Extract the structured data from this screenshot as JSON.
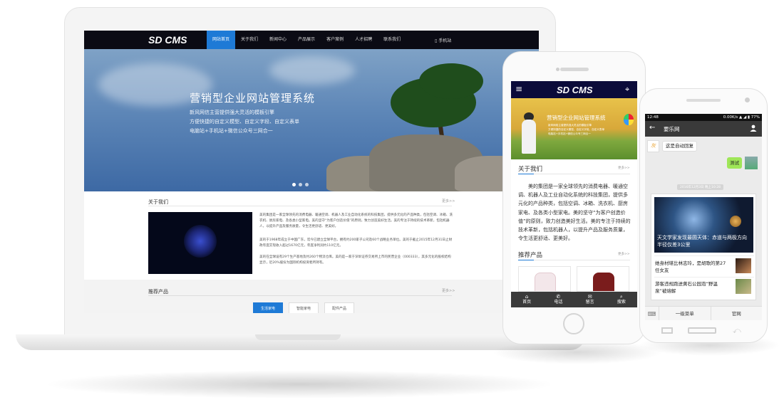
{
  "desktop": {
    "logo": "SD CMS",
    "menu": [
      "网站首页",
      "关于我们",
      "新闻中心",
      "产品展示",
      "客户案例",
      "人才招聘",
      "联系我们"
    ],
    "mobile_link": "手机站",
    "hero": {
      "title": "营销型企业网站管理系统",
      "lines": [
        "新风网信主营提供强大灵活的模板引擎",
        "方便快捷的自定义模型、自定义字段、自定义表单",
        "电脑站+手机站+微信公众号三网合一"
      ]
    },
    "about_heading": "关于我们",
    "more": "更多>>",
    "about_paragraphs": [
      "美的集团是一家全球领先的消费电器、暖通空调、机器人及工业自动化系统的科技集团，提供多元化的产品种类，包括空调、冰箱、洗衣机、厨房家电、及各类小型家电。美的坚守“为客户创造价值”的原则，致力创造美好生活。美的专注于持续的技术革新，包括机器人，以提升产品及服务质量，令生活更舒适、更美好。",
      "美的于1968年成立于中国广东，迄今已建立全球平台，拥有约200家子公司及60个战略业务单位。美的于截止2015年12月31日止财政年度实现收入超过1670亿元，年度净利润约110亿元。",
      "美的在全球设有29个生产基地及约260个物流仓库。美的是一家于深圳证券交易所上市的民营企业（000333），其多元化的股权结构显示，近20%股份为国际机构投资者所持有。"
    ],
    "rec_heading": "推荐产品",
    "rec_tabs": [
      "生活家电",
      "智能家电",
      "配件产品"
    ]
  },
  "mobile": {
    "logo": "SD CMS",
    "banner_title": "营销型企业网站管理系统",
    "banner_lines": [
      "新风网络主营提供强大灵活的模板引擎",
      "方便快捷的自定义模型、自定义字段、自定义表单",
      "电脑站+手机站+微信公众号三网合一"
    ],
    "about_heading": "关于我们",
    "more": "更多>>",
    "about_text": "美的集团是一家全球领先的消费电器、暖通空调、机器人及工业自动化系统的科技集团，提供多元化的产品种类，包括空调、冰箱、洗衣机、厨房家电、及各类小型家电。美的坚守“为客户创造价值”的原则，致力创造美好生活。美的专注于持续的技术革新，包括机器人，以提升产品及服务质量，令生活更舒适、更美好。",
    "products_heading": "推荐产品",
    "footer": [
      {
        "label": "首页",
        "icon": "home-icon",
        "glyph": "⌂"
      },
      {
        "label": "电话",
        "icon": "phone-icon",
        "glyph": "✆"
      },
      {
        "label": "留言",
        "icon": "message-icon",
        "glyph": "✉"
      },
      {
        "label": "搜索",
        "icon": "search-icon",
        "glyph": "⌕"
      }
    ]
  },
  "wechat": {
    "status_time": "12:48",
    "status_right": "0.00K/s ▲ ◢ ▮ 77%",
    "title": "要乐网",
    "auto_reply": "这是自动回复",
    "my_message": "测试",
    "time_label": "2016年12月3日 晚上10:28",
    "card_headline": "天文学家发现最圆天体：赤道与两极方向半径仅差3公里",
    "news": [
      "她身材堪比林志玲，是胡歌的第27任女友",
      "游客违规跑进黄石公园泡“野温泉”被熔解"
    ],
    "bottom_menu": [
      "一级菜单",
      "官网"
    ]
  },
  "colors": {
    "accent": "#1e7ad6",
    "nav_dark": "#0b0b14",
    "wechat_green": "#9fe658"
  }
}
